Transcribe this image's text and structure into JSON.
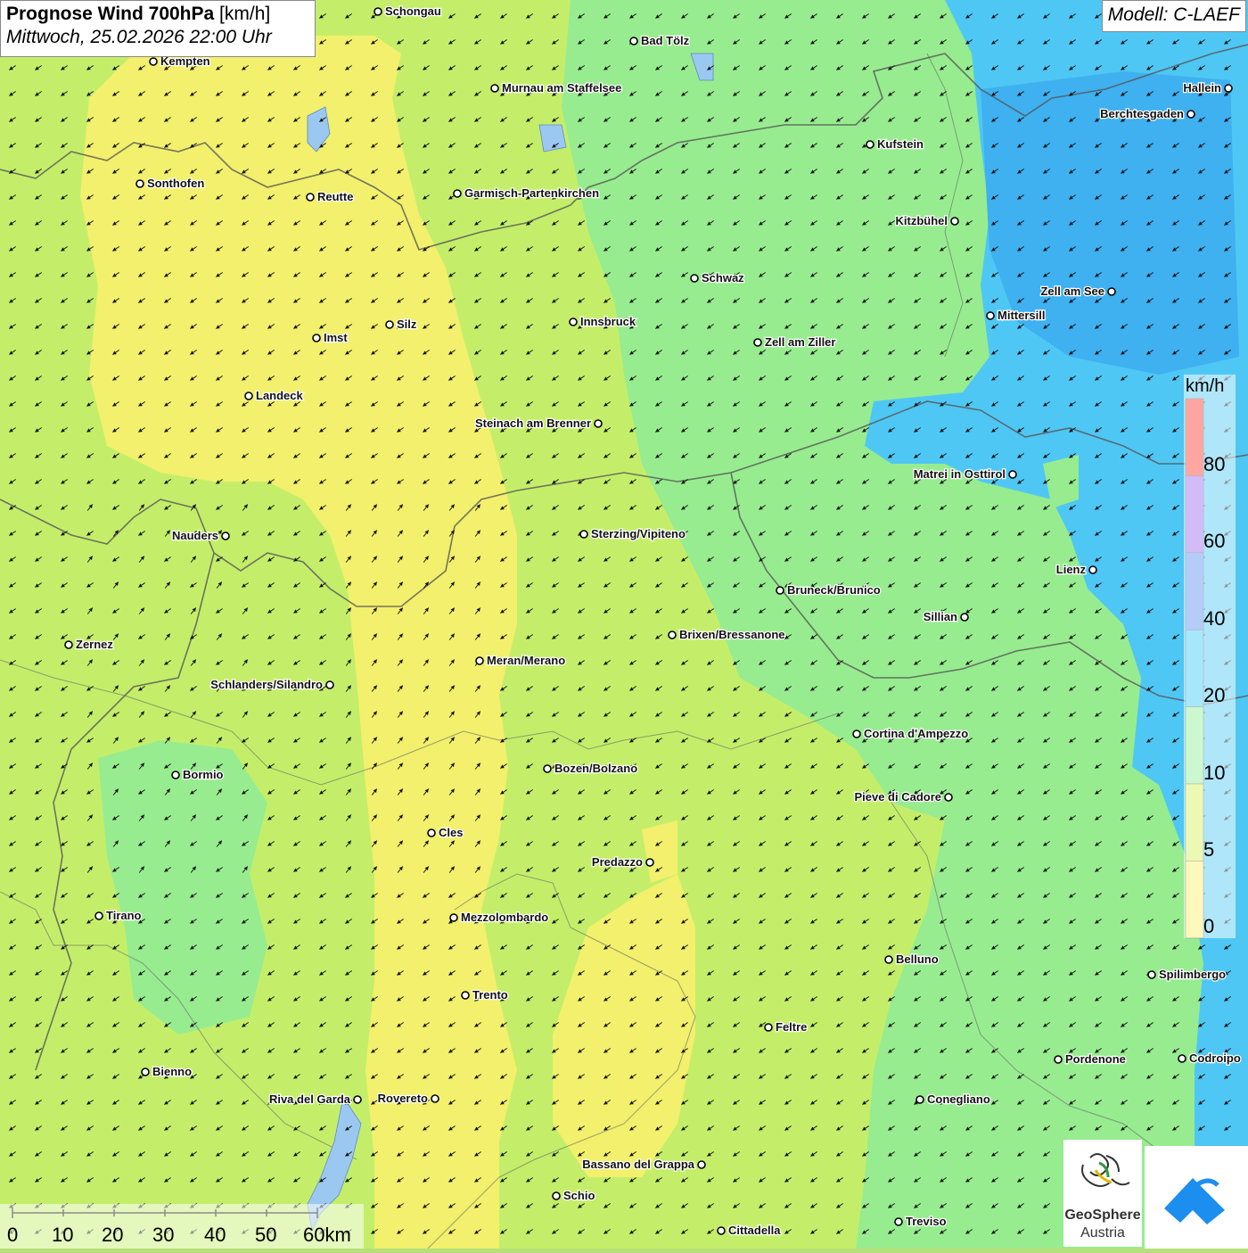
{
  "header": {
    "title_bold": "Prognose Wind 700hPa",
    "title_unit": "[km/h]",
    "datetime": "Mittwoch, 25.02.2026 22:00 Uhr",
    "model": "Modell: C-LAEF"
  },
  "legend": {
    "unit": "km/h",
    "ticks": [
      "80",
      "60",
      "40",
      "20",
      "10",
      "5",
      "0"
    ],
    "colors": [
      "#ff3b30",
      "#9b6cf0",
      "#5a8ff0",
      "#3ccaf5",
      "#8ef094",
      "#d6f25a",
      "#fff068"
    ]
  },
  "scale_bar": {
    "labels": [
      "0",
      "10",
      "20",
      "30",
      "40",
      "50",
      "60km"
    ]
  },
  "logos": {
    "geosphere_line1": "GeoSphere",
    "geosphere_line2": "Austria"
  },
  "cities": [
    {
      "name": "Schongau"
    },
    {
      "name": "Bad Tölz"
    },
    {
      "name": "Kempten"
    },
    {
      "name": "Murnau am Staffelsee"
    },
    {
      "name": "Hallein"
    },
    {
      "name": "Berchtesgaden"
    },
    {
      "name": "Kufstein"
    },
    {
      "name": "Sonthofen"
    },
    {
      "name": "Reutte"
    },
    {
      "name": "Garmisch-Partenkirchen"
    },
    {
      "name": "Kitzbühel"
    },
    {
      "name": "Schwaz"
    },
    {
      "name": "Zell am See"
    },
    {
      "name": "Mittersill"
    },
    {
      "name": "Innsbruck"
    },
    {
      "name": "Silz"
    },
    {
      "name": "Imst"
    },
    {
      "name": "Zell am Ziller"
    },
    {
      "name": "Landeck"
    },
    {
      "name": "Steinach am Brenner"
    },
    {
      "name": "Matrei in Osttirol"
    },
    {
      "name": "Nauders"
    },
    {
      "name": "Sterzing/Vipiteno"
    },
    {
      "name": "Lienz"
    },
    {
      "name": "Bruneck/Brunico"
    },
    {
      "name": "Sillian"
    },
    {
      "name": "Brixen/Bressanone"
    },
    {
      "name": "Zernez"
    },
    {
      "name": "Meran/Merano"
    },
    {
      "name": "Schlanders/Silandro"
    },
    {
      "name": "Cortina d'Ampezzo"
    },
    {
      "name": "Bozen/Bolzano"
    },
    {
      "name": "Bormio"
    },
    {
      "name": "Pieve di Cadore"
    },
    {
      "name": "Cles"
    },
    {
      "name": "Predazzo"
    },
    {
      "name": "Tirano"
    },
    {
      "name": "Mezzolombardo"
    },
    {
      "name": "Belluno"
    },
    {
      "name": "Spilimbergo"
    },
    {
      "name": "Trento"
    },
    {
      "name": "Feltre"
    },
    {
      "name": "Pordenone"
    },
    {
      "name": "Codroipo"
    },
    {
      "name": "Bienno"
    },
    {
      "name": "Riva del Garda"
    },
    {
      "name": "Rovereto"
    },
    {
      "name": "Conegliano"
    },
    {
      "name": "Bassano del Grappa"
    },
    {
      "name": "Schio"
    },
    {
      "name": "Treviso"
    },
    {
      "name": "Cittadella"
    }
  ]
}
